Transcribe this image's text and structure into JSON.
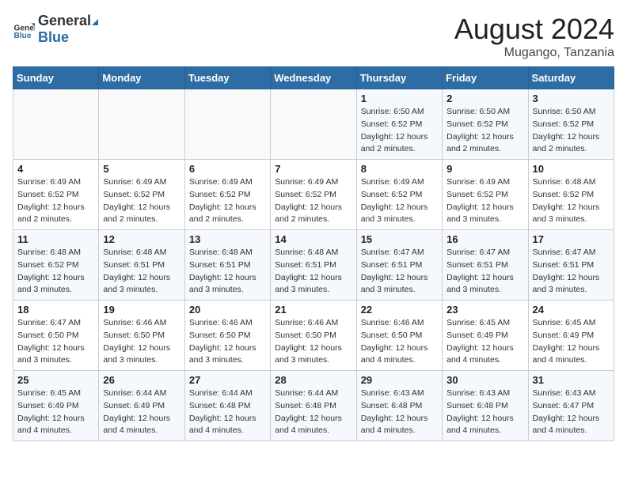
{
  "header": {
    "logo_general": "General",
    "logo_blue": "Blue",
    "month_title": "August 2024",
    "location": "Mugango, Tanzania"
  },
  "days_of_week": [
    "Sunday",
    "Monday",
    "Tuesday",
    "Wednesday",
    "Thursday",
    "Friday",
    "Saturday"
  ],
  "weeks": [
    [
      {
        "day": "",
        "detail": ""
      },
      {
        "day": "",
        "detail": ""
      },
      {
        "day": "",
        "detail": ""
      },
      {
        "day": "",
        "detail": ""
      },
      {
        "day": "1",
        "detail": "Sunrise: 6:50 AM\nSunset: 6:52 PM\nDaylight: 12 hours\nand 2 minutes."
      },
      {
        "day": "2",
        "detail": "Sunrise: 6:50 AM\nSunset: 6:52 PM\nDaylight: 12 hours\nand 2 minutes."
      },
      {
        "day": "3",
        "detail": "Sunrise: 6:50 AM\nSunset: 6:52 PM\nDaylight: 12 hours\nand 2 minutes."
      }
    ],
    [
      {
        "day": "4",
        "detail": "Sunrise: 6:49 AM\nSunset: 6:52 PM\nDaylight: 12 hours\nand 2 minutes."
      },
      {
        "day": "5",
        "detail": "Sunrise: 6:49 AM\nSunset: 6:52 PM\nDaylight: 12 hours\nand 2 minutes."
      },
      {
        "day": "6",
        "detail": "Sunrise: 6:49 AM\nSunset: 6:52 PM\nDaylight: 12 hours\nand 2 minutes."
      },
      {
        "day": "7",
        "detail": "Sunrise: 6:49 AM\nSunset: 6:52 PM\nDaylight: 12 hours\nand 2 minutes."
      },
      {
        "day": "8",
        "detail": "Sunrise: 6:49 AM\nSunset: 6:52 PM\nDaylight: 12 hours\nand 3 minutes."
      },
      {
        "day": "9",
        "detail": "Sunrise: 6:49 AM\nSunset: 6:52 PM\nDaylight: 12 hours\nand 3 minutes."
      },
      {
        "day": "10",
        "detail": "Sunrise: 6:48 AM\nSunset: 6:52 PM\nDaylight: 12 hours\nand 3 minutes."
      }
    ],
    [
      {
        "day": "11",
        "detail": "Sunrise: 6:48 AM\nSunset: 6:52 PM\nDaylight: 12 hours\nand 3 minutes."
      },
      {
        "day": "12",
        "detail": "Sunrise: 6:48 AM\nSunset: 6:51 PM\nDaylight: 12 hours\nand 3 minutes."
      },
      {
        "day": "13",
        "detail": "Sunrise: 6:48 AM\nSunset: 6:51 PM\nDaylight: 12 hours\nand 3 minutes."
      },
      {
        "day": "14",
        "detail": "Sunrise: 6:48 AM\nSunset: 6:51 PM\nDaylight: 12 hours\nand 3 minutes."
      },
      {
        "day": "15",
        "detail": "Sunrise: 6:47 AM\nSunset: 6:51 PM\nDaylight: 12 hours\nand 3 minutes."
      },
      {
        "day": "16",
        "detail": "Sunrise: 6:47 AM\nSunset: 6:51 PM\nDaylight: 12 hours\nand 3 minutes."
      },
      {
        "day": "17",
        "detail": "Sunrise: 6:47 AM\nSunset: 6:51 PM\nDaylight: 12 hours\nand 3 minutes."
      }
    ],
    [
      {
        "day": "18",
        "detail": "Sunrise: 6:47 AM\nSunset: 6:50 PM\nDaylight: 12 hours\nand 3 minutes."
      },
      {
        "day": "19",
        "detail": "Sunrise: 6:46 AM\nSunset: 6:50 PM\nDaylight: 12 hours\nand 3 minutes."
      },
      {
        "day": "20",
        "detail": "Sunrise: 6:46 AM\nSunset: 6:50 PM\nDaylight: 12 hours\nand 3 minutes."
      },
      {
        "day": "21",
        "detail": "Sunrise: 6:46 AM\nSunset: 6:50 PM\nDaylight: 12 hours\nand 3 minutes."
      },
      {
        "day": "22",
        "detail": "Sunrise: 6:46 AM\nSunset: 6:50 PM\nDaylight: 12 hours\nand 4 minutes."
      },
      {
        "day": "23",
        "detail": "Sunrise: 6:45 AM\nSunset: 6:49 PM\nDaylight: 12 hours\nand 4 minutes."
      },
      {
        "day": "24",
        "detail": "Sunrise: 6:45 AM\nSunset: 6:49 PM\nDaylight: 12 hours\nand 4 minutes."
      }
    ],
    [
      {
        "day": "25",
        "detail": "Sunrise: 6:45 AM\nSunset: 6:49 PM\nDaylight: 12 hours\nand 4 minutes."
      },
      {
        "day": "26",
        "detail": "Sunrise: 6:44 AM\nSunset: 6:49 PM\nDaylight: 12 hours\nand 4 minutes."
      },
      {
        "day": "27",
        "detail": "Sunrise: 6:44 AM\nSunset: 6:48 PM\nDaylight: 12 hours\nand 4 minutes."
      },
      {
        "day": "28",
        "detail": "Sunrise: 6:44 AM\nSunset: 6:48 PM\nDaylight: 12 hours\nand 4 minutes."
      },
      {
        "day": "29",
        "detail": "Sunrise: 6:43 AM\nSunset: 6:48 PM\nDaylight: 12 hours\nand 4 minutes."
      },
      {
        "day": "30",
        "detail": "Sunrise: 6:43 AM\nSunset: 6:48 PM\nDaylight: 12 hours\nand 4 minutes."
      },
      {
        "day": "31",
        "detail": "Sunrise: 6:43 AM\nSunset: 6:47 PM\nDaylight: 12 hours\nand 4 minutes."
      }
    ]
  ]
}
